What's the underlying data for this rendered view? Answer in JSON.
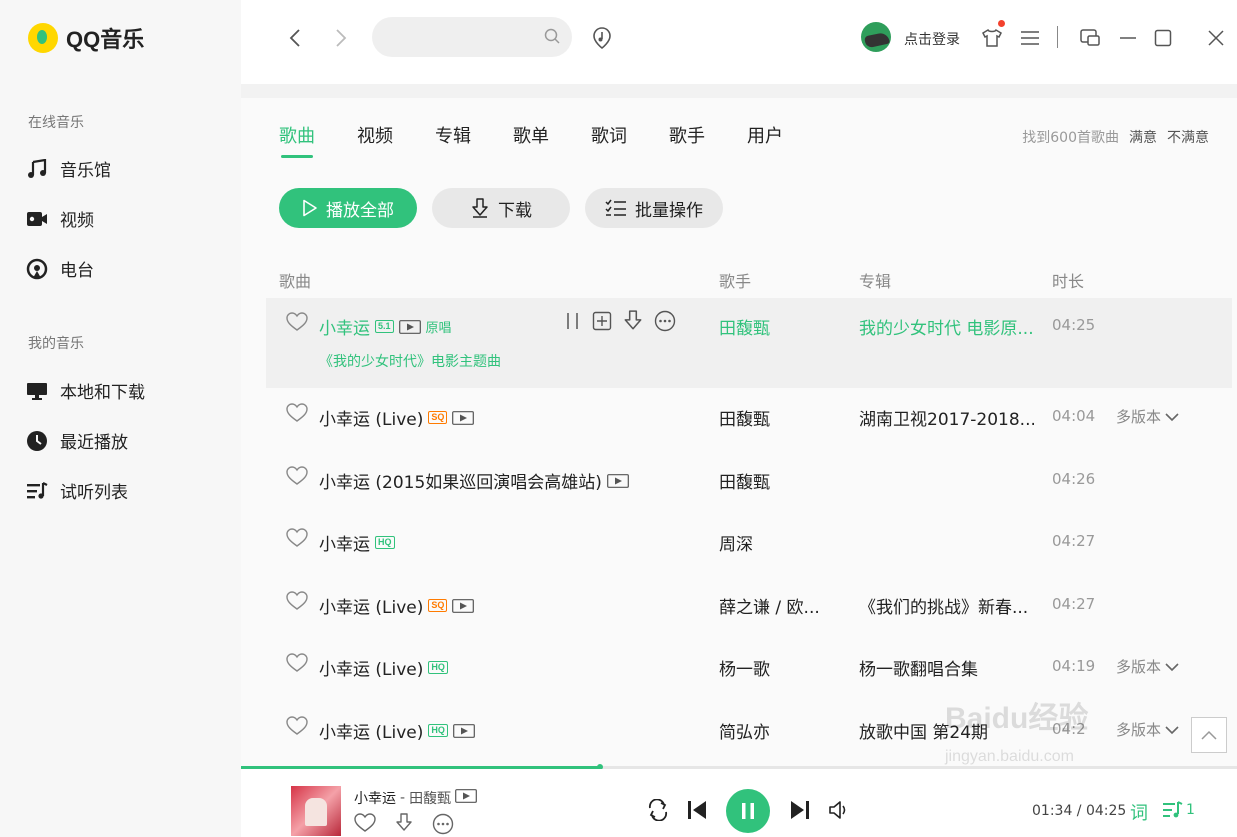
{
  "app": {
    "name": "QQ音乐",
    "brand_color": "#31c27c"
  },
  "sidebar": {
    "sections": [
      {
        "label": "在线音乐",
        "items": [
          {
            "label": "音乐馆",
            "icon": "music-note-icon"
          },
          {
            "label": "视频",
            "icon": "video-icon"
          },
          {
            "label": "电台",
            "icon": "radio-icon"
          }
        ]
      },
      {
        "label": "我的音乐",
        "items": [
          {
            "label": "本地和下载",
            "icon": "monitor-icon"
          },
          {
            "label": "最近播放",
            "icon": "clock-icon"
          },
          {
            "label": "试听列表",
            "icon": "playlist-icon"
          }
        ]
      }
    ]
  },
  "topbar": {
    "search_placeholder": "",
    "login_label": "点击登录"
  },
  "search_results": {
    "tabs": [
      "歌曲",
      "视频",
      "专辑",
      "歌单",
      "歌词",
      "歌手",
      "用户"
    ],
    "active_tab": "歌曲",
    "found_text": "找到600首歌曲",
    "satisfied": "满意",
    "unsatisfied": "不满意",
    "buttons": {
      "play_all": "播放全部",
      "download": "下载",
      "batch": "批量操作"
    },
    "columns": {
      "song": "歌曲",
      "singer": "歌手",
      "album": "专辑",
      "duration": "时长"
    },
    "rows": [
      {
        "title": "小幸运",
        "badge": "5.1",
        "mv": true,
        "original": "原唱",
        "subtitle": "《我的少女时代》电影主题曲",
        "singer": "田馥甄",
        "album": "我的少女时代 电影原...",
        "duration": "04:25",
        "multi": ""
      },
      {
        "title": "小幸运 (Live)",
        "badge": "SQ",
        "mv": true,
        "singer": "田馥甄",
        "album": "湖南卫视2017-2018...",
        "duration": "04:04",
        "multi": "多版本"
      },
      {
        "title": "小幸运 (2015如果巡回演唱会高雄站)",
        "badge": "",
        "mv": true,
        "singer": "田馥甄",
        "album": "",
        "duration": "04:26",
        "multi": ""
      },
      {
        "title": "小幸运",
        "badge": "HQ",
        "mv": false,
        "singer": "周深",
        "album": "",
        "duration": "04:27",
        "multi": ""
      },
      {
        "title": "小幸运 (Live)",
        "badge": "SQ",
        "mv": true,
        "singer": "薛之谦 / 欧...",
        "album": "《我们的挑战》新春...",
        "duration": "04:27",
        "multi": ""
      },
      {
        "title": "小幸运 (Live)",
        "badge": "HQ",
        "mv": false,
        "singer": "杨一歌",
        "album": "杨一歌翻唱合集",
        "duration": "04:19",
        "multi": "多版本"
      },
      {
        "title": "小幸运 (Live)",
        "badge": "HQ",
        "mv": true,
        "singer": "简弘亦",
        "album": "放歌中国 第24期",
        "duration": "04:2",
        "multi": "多版本"
      }
    ]
  },
  "player": {
    "title": "小幸运",
    "separator": "-",
    "artist": "田馥甄",
    "time": "01:34 / 04:25",
    "progress": 0.36,
    "lyric_label": "词",
    "queue_count": "1"
  },
  "watermark": {
    "line1": "Baidu经验",
    "line2": "jingyan.baidu.com"
  }
}
